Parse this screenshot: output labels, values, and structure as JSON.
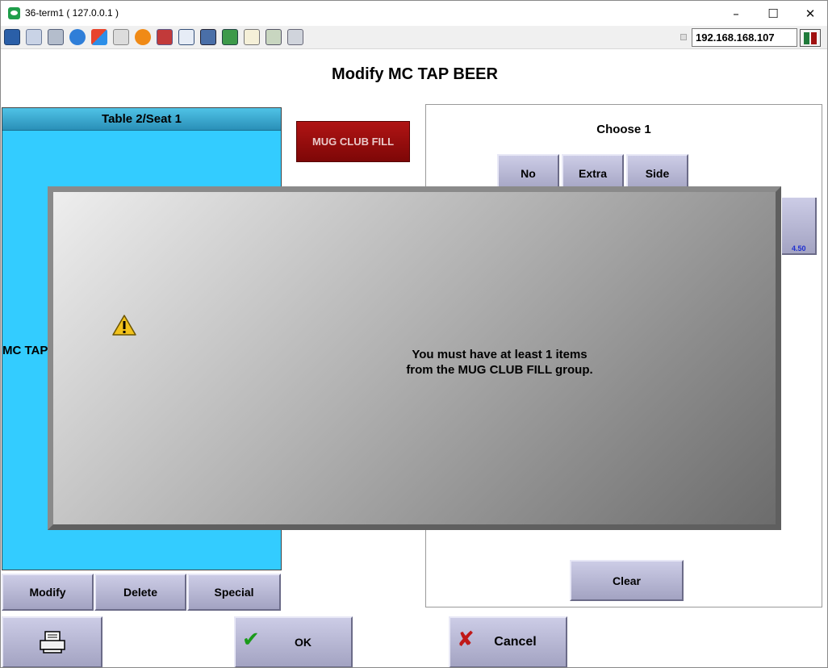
{
  "window": {
    "title": "36-term1 ( 127.0.0.1 )",
    "minimize_glyph": "–",
    "maximize_glyph": "☐",
    "close_glyph": "✕"
  },
  "toolbar": {
    "icons": [
      "monitor-icon",
      "windows-icon",
      "tools-icon",
      "refresh-icon",
      "windows-logo-icon",
      "keyboard-icon",
      "alert-icon",
      "network-icon",
      "fullscreen-icon",
      "display-icon",
      "transfer-icon",
      "document-icon",
      "screenshot-icon",
      "chat-icon"
    ],
    "ip_address": "192.168.168.107"
  },
  "screen": {
    "title": "Modify MC TAP BEER"
  },
  "left_panel": {
    "header": "Table 2/Seat 1",
    "item": "MC TAP",
    "buttons": {
      "modify": "Modify",
      "delete": "Delete",
      "special": "Special"
    }
  },
  "group_button": {
    "label": "MUG CLUB FILL"
  },
  "right_panel": {
    "choose_label": "Choose 1",
    "modifier_buttons": {
      "no": "No",
      "extra": "Extra",
      "side": "Side"
    },
    "price": "4.50",
    "clear": "Clear"
  },
  "dialog": {
    "line1": "You must have at least 1 items",
    "line2": "from the MUG CLUB FILL group."
  },
  "bottom_buttons": {
    "ok": "OK",
    "cancel": "Cancel"
  },
  "colors": {
    "panel_blue": "#33ccff",
    "group_red": "#9b0e0e",
    "button_purple": "#b8b8d8"
  }
}
